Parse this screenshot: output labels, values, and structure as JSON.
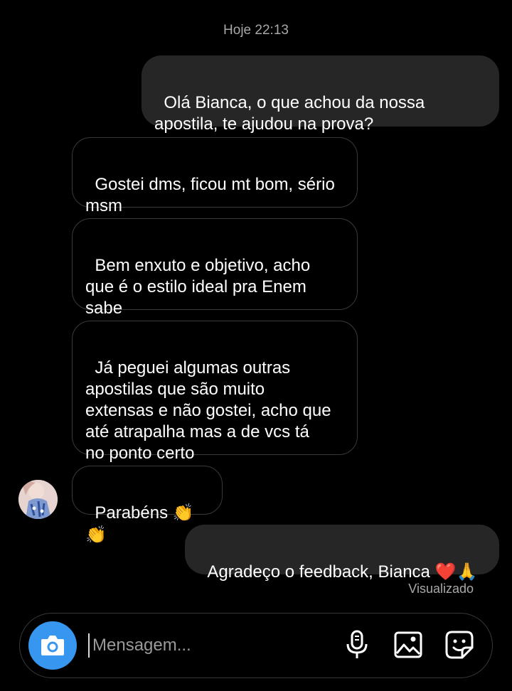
{
  "header": {
    "timestamp": "Hoje 22:13"
  },
  "messages": [
    {
      "direction": "out",
      "text": "Olá Bianca, o que achou da nossa\napostila, te ajudou na prova?"
    },
    {
      "direction": "in",
      "text": "Gostei dms, ficou mt bom, sério\nmsm"
    },
    {
      "direction": "in",
      "text": "Bem enxuto e objetivo, acho\nque é o estilo ideal pra Enem\nsabe"
    },
    {
      "direction": "in",
      "text": "Já peguei algumas outras\napostilas que são muito\nextensas e não gostei, acho que\naté atrapalha mas a de vcs tá\nno ponto certo"
    },
    {
      "direction": "in",
      "text": "Parabéns ",
      "emoji": "👏👏"
    },
    {
      "direction": "out",
      "text": "Agradeço o feedback, Bianca ",
      "emoji": "❤️🙏"
    }
  ],
  "seen_status": "Visualizado",
  "composer": {
    "placeholder": "Mensagem...",
    "icons": [
      "camera-icon",
      "microphone-icon",
      "gallery-icon",
      "sticker-icon"
    ]
  },
  "colors": {
    "background": "#000000",
    "outgoing_bubble": "#262626",
    "incoming_border": "#3a3a3a",
    "camera_button": "#3797f0",
    "muted_text": "#a8a8a8"
  }
}
